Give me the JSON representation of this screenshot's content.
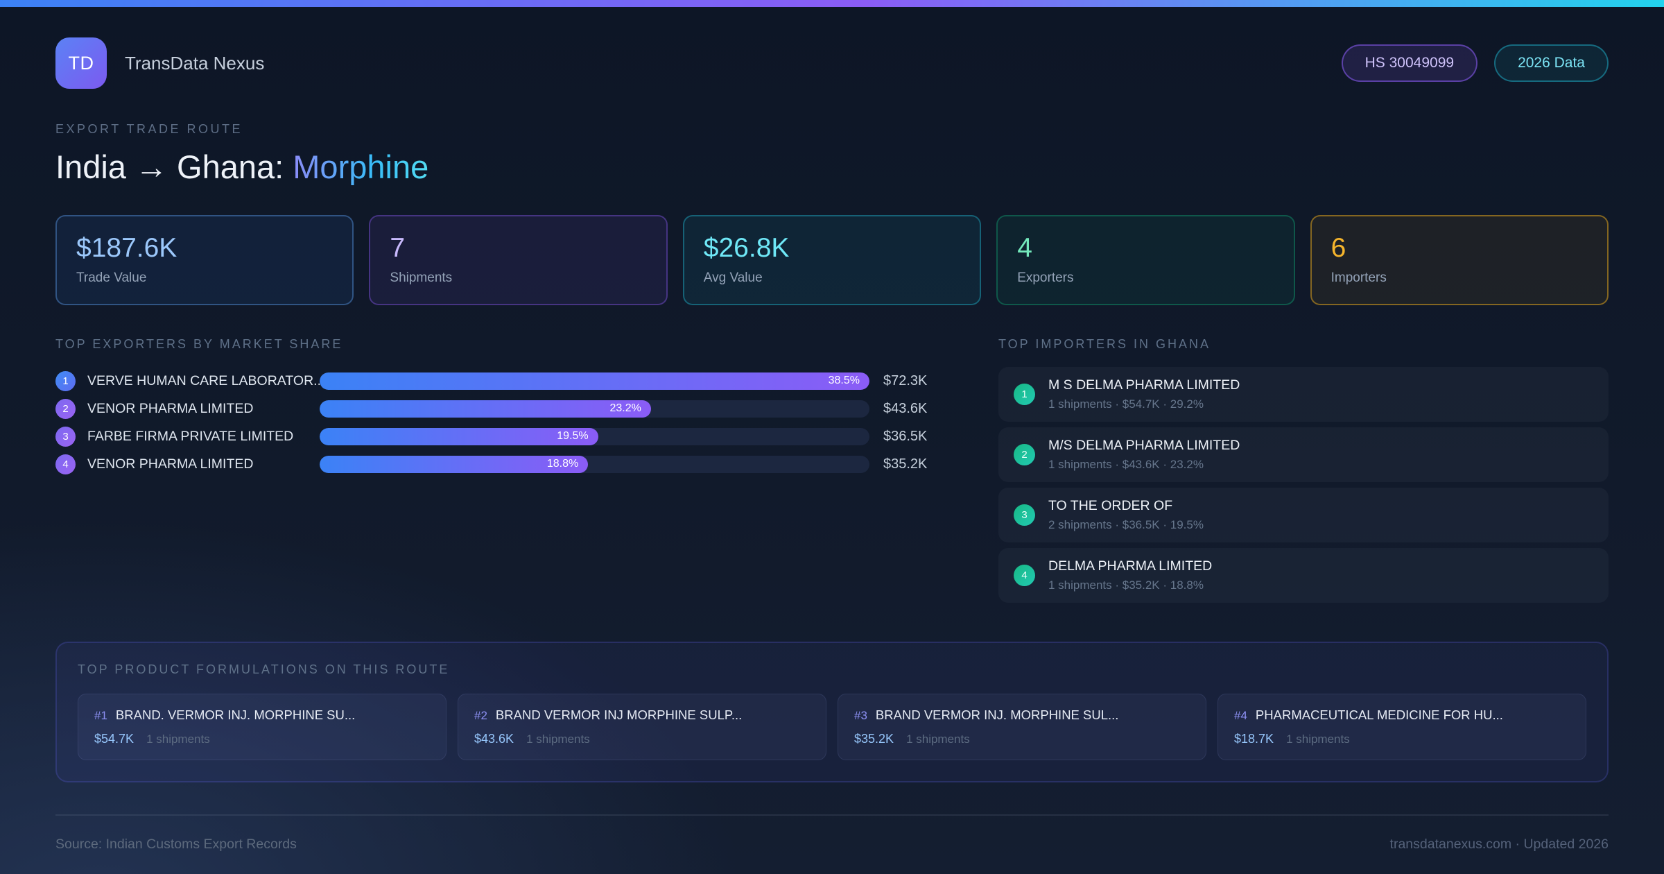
{
  "brand": {
    "logo_text": "TD",
    "name": "TransData Nexus"
  },
  "header_badges": {
    "hs_code": "HS 30049099",
    "data_year": "2026 Data"
  },
  "route": {
    "eyebrow": "EXPORT TRADE ROUTE",
    "title_route": "India → Ghana:",
    "title_product": "Morphine"
  },
  "stats": [
    {
      "value": "$187.6K",
      "label": "Trade Value"
    },
    {
      "value": "7",
      "label": "Shipments"
    },
    {
      "value": "$26.8K",
      "label": "Avg Value"
    },
    {
      "value": "4",
      "label": "Exporters"
    },
    {
      "value": "6",
      "label": "Importers"
    }
  ],
  "exporters": {
    "title": "TOP EXPORTERS BY MARKET SHARE",
    "items": [
      {
        "rank": "1",
        "name": "VERVE HUMAN CARE LABORATOR...",
        "share_pct": 38.5,
        "share_label": "38.5%",
        "value": "$72.3K"
      },
      {
        "rank": "2",
        "name": "VENOR PHARMA LIMITED",
        "share_pct": 23.2,
        "share_label": "23.2%",
        "value": "$43.6K"
      },
      {
        "rank": "3",
        "name": "FARBE FIRMA PRIVATE LIMITED",
        "share_pct": 19.5,
        "share_label": "19.5%",
        "value": "$36.5K"
      },
      {
        "rank": "4",
        "name": "VENOR PHARMA LIMITED",
        "share_pct": 18.8,
        "share_label": "18.8%",
        "value": "$35.2K"
      }
    ]
  },
  "importers": {
    "title": "TOP IMPORTERS IN GHANA",
    "items": [
      {
        "rank": "1",
        "name": "M S DELMA PHARMA LIMITED",
        "details": "1 shipments · $54.7K · 29.2%"
      },
      {
        "rank": "2",
        "name": "M/S DELMA PHARMA LIMITED",
        "details": "1 shipments · $43.6K · 23.2%"
      },
      {
        "rank": "3",
        "name": "TO THE ORDER OF",
        "details": "2 shipments · $36.5K · 19.5%"
      },
      {
        "rank": "4",
        "name": "DELMA PHARMA LIMITED",
        "details": "1 shipments · $35.2K · 18.8%"
      }
    ]
  },
  "formulations": {
    "title": "TOP PRODUCT FORMULATIONS ON THIS ROUTE",
    "items": [
      {
        "rank": "#1",
        "name": "BRAND. VERMOR INJ. MORPHINE SU...",
        "value": "$54.7K",
        "shipments": "1 shipments"
      },
      {
        "rank": "#2",
        "name": "BRAND VERMOR INJ MORPHINE SULP...",
        "value": "$43.6K",
        "shipments": "1 shipments"
      },
      {
        "rank": "#3",
        "name": "BRAND VERMOR INJ. MORPHINE SUL...",
        "value": "$35.2K",
        "shipments": "1 shipments"
      },
      {
        "rank": "#4",
        "name": "PHARMACEUTICAL MEDICINE FOR HU...",
        "value": "$18.7K",
        "shipments": "1 shipments"
      }
    ]
  },
  "footer": {
    "source": "Source: Indian Customs Export Records",
    "site": "transdatanexus.com · Updated 2026"
  },
  "theme": {
    "accent_blue": "#3b82f6",
    "accent_purple": "#8b5cf6",
    "accent_cyan": "#22d3ee",
    "accent_green": "#10b981",
    "accent_amber": "#f6b52c",
    "background": "#101a2b"
  }
}
